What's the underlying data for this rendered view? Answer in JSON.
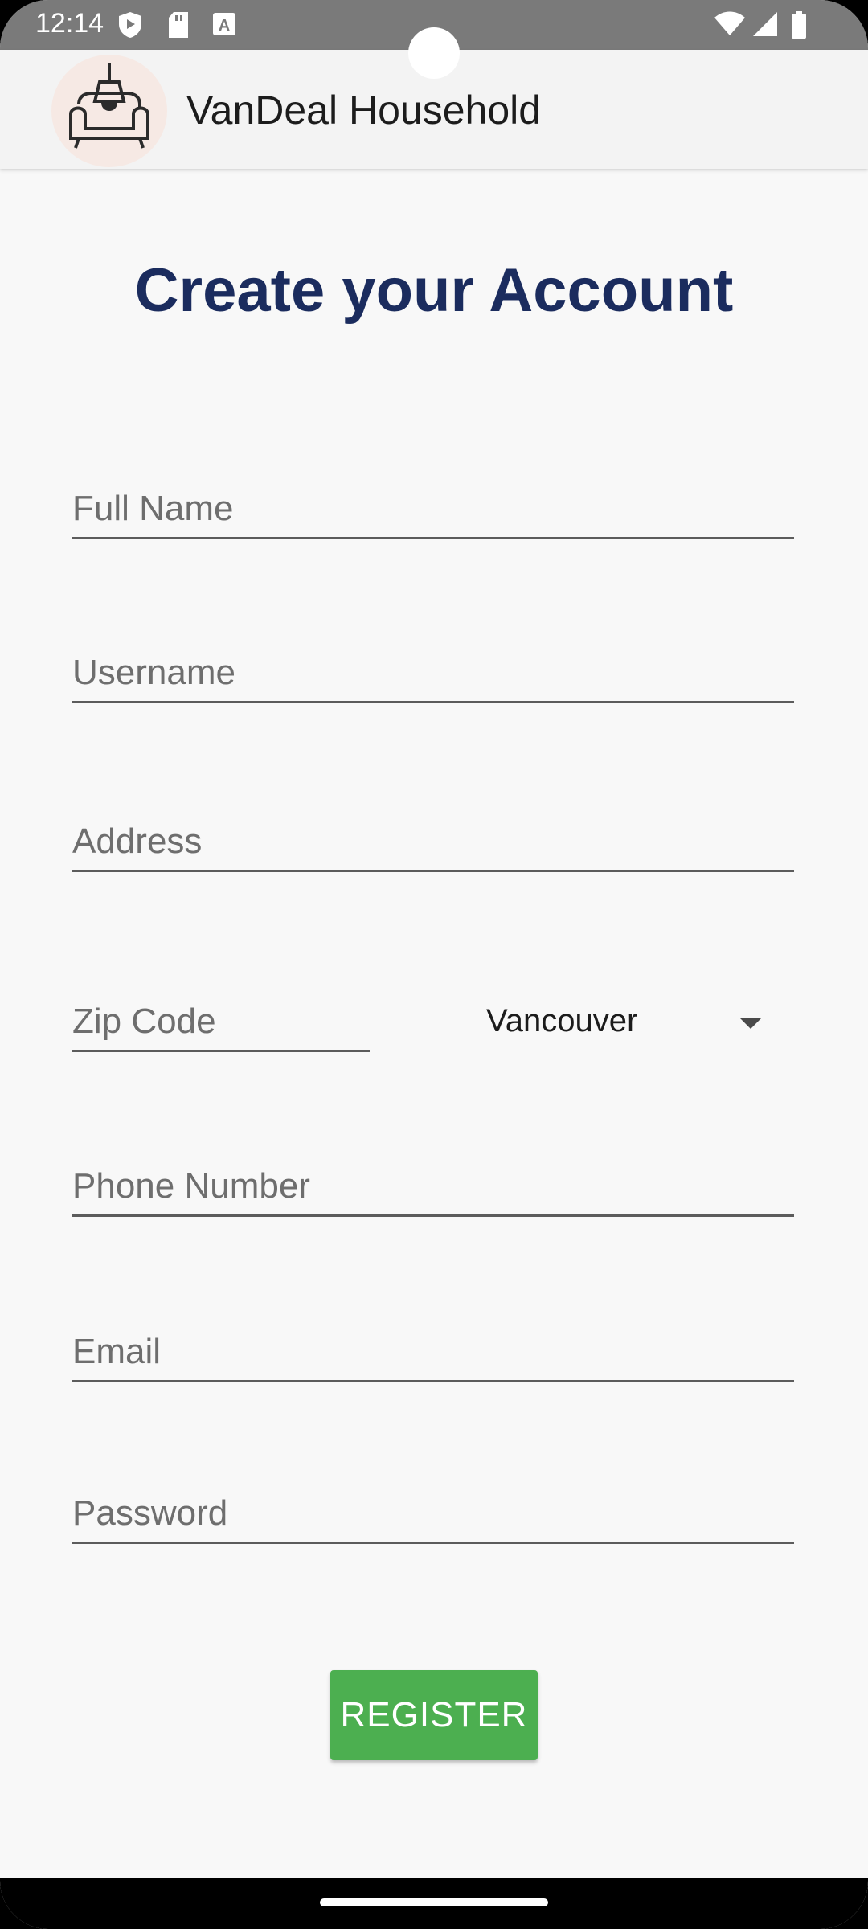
{
  "status_bar": {
    "time": "12:14",
    "icons": [
      "shield-icon",
      "sd-card-icon",
      "keyboard-a-icon",
      "wifi-icon",
      "signal-icon",
      "battery-icon"
    ]
  },
  "app_bar": {
    "title": "VanDeal Household",
    "logo_icon": "armchair-lamp-logo"
  },
  "form": {
    "title": "Create your Account",
    "fields": {
      "full_name": "Full Name",
      "username": "Username",
      "address": "Address",
      "zip_code": "Zip Code",
      "phone": "Phone Number",
      "email": "Email",
      "password": "Password"
    },
    "city_select": {
      "selected": "Vancouver"
    },
    "register_label": "REGISTER"
  },
  "colors": {
    "title": "#1b2c5e",
    "button": "#4caf50",
    "status_bar": "#7a7a7a"
  }
}
